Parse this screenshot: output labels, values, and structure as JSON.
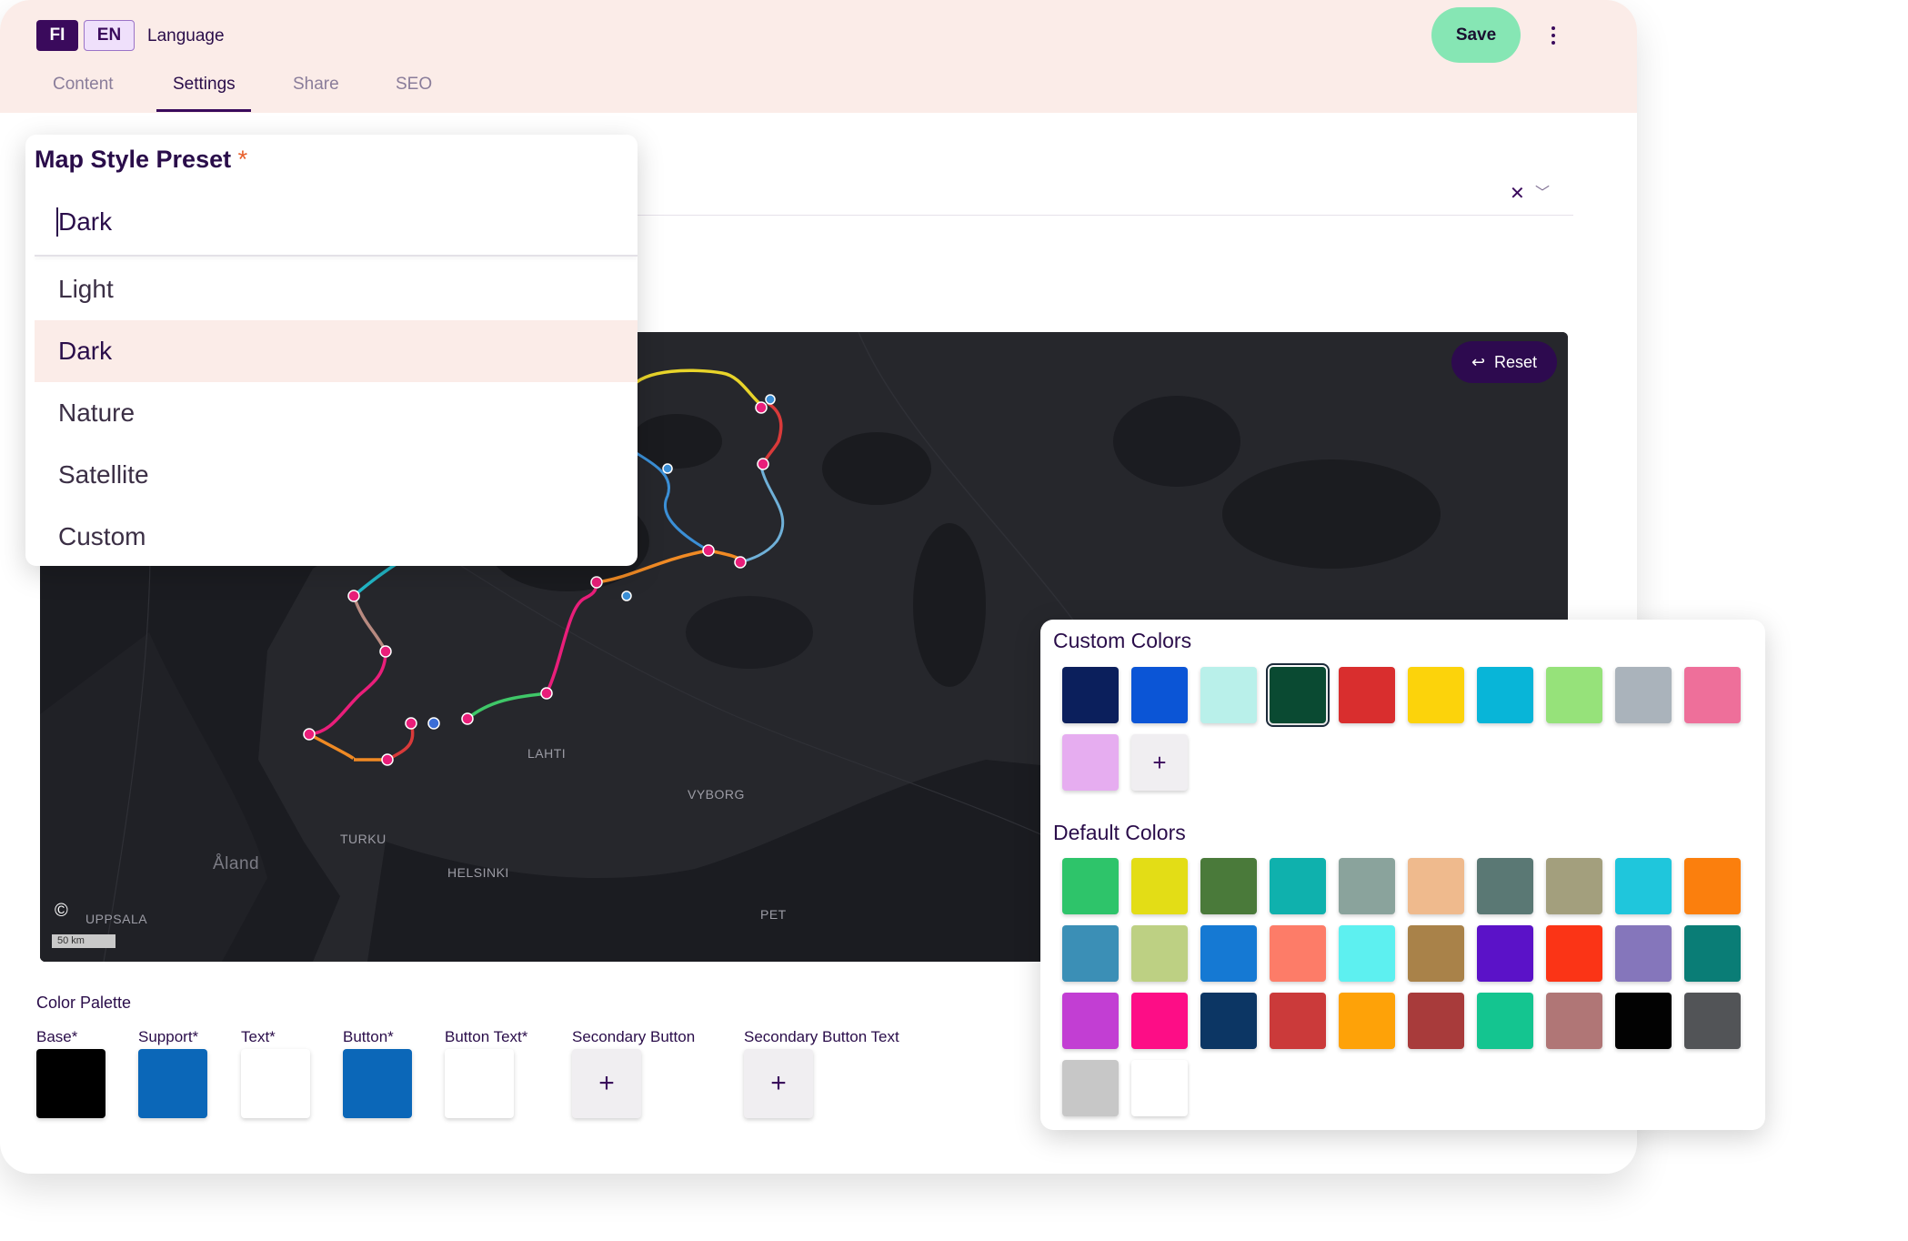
{
  "header": {
    "lang_fi": "FI",
    "lang_en": "EN",
    "language_label": "Language",
    "save_label": "Save",
    "tabs": [
      {
        "label": "Content"
      },
      {
        "label": "Settings"
      },
      {
        "label": "Share"
      },
      {
        "label": "SEO"
      }
    ],
    "active_tab": "Settings"
  },
  "map_style": {
    "title": "Map Style Preset",
    "required_mark": "*",
    "value": "Dark",
    "options": [
      "Light",
      "Dark",
      "Nature",
      "Satellite",
      "Custom"
    ],
    "selected": "Dark"
  },
  "map": {
    "reset_label": "Reset",
    "labels": [
      "LAHTI",
      "VYBORG",
      "TURKU",
      "HELSINKI",
      "Åland",
      "UPPSALA",
      "PET"
    ],
    "scale": "50 km",
    "copyright": "©",
    "route_colors": [
      "#e8d42a",
      "#d93a3a",
      "#3b8fd6",
      "#22b8c8",
      "#f08a24",
      "#a87bd0",
      "#e7b48a",
      "#e91e7a",
      "#b88a80",
      "#3fc768",
      "#6fb0d8"
    ]
  },
  "palette": {
    "title": "Color Palette",
    "items": [
      {
        "label": "Base*",
        "color": "#000000"
      },
      {
        "label": "Support*",
        "color": "#0b67b8"
      },
      {
        "label": "Text*",
        "color": "#ffffff"
      },
      {
        "label": "Button*",
        "color": "#0b67b8"
      },
      {
        "label": "Button Text*",
        "color": "#ffffff"
      },
      {
        "label": "Secondary Button",
        "color": ""
      },
      {
        "label": "Secondary Button Text",
        "color": ""
      }
    ],
    "plus": "+"
  },
  "picker": {
    "custom_title": "Custom Colors",
    "default_title": "Default Colors",
    "custom_colors": [
      "#0b1f5c",
      "#0b55d6",
      "#b9f0ea",
      "#0a4a32",
      "#d92e2e",
      "#fcd30b",
      "#08b5d8",
      "#96e27a",
      "#aab3bb",
      "#ee6f9a",
      "#e6adf0"
    ],
    "selected_custom": "#0a4a32",
    "plus": "+",
    "default_colors": [
      "#2ec46a",
      "#e3dd16",
      "#4a7a3a",
      "#0fb1ad",
      "#8aa39c",
      "#efba8d",
      "#5a7874",
      "#a39f7d",
      "#1fc6dc",
      "#fb7f0d",
      "#3b8fb6",
      "#bdd083",
      "#1579d3",
      "#fd7c68",
      "#5df0f0",
      "#a98249",
      "#5b12c8",
      "#fb3416",
      "#8576bb",
      "#0a7d76",
      "#c23ed3",
      "#fd0d86",
      "#0c3664",
      "#cb3a3a",
      "#fea208",
      "#a83b3b",
      "#14c590",
      "#b07676",
      "#020202",
      "#525457",
      "#c7c7c7",
      "#ffffff"
    ]
  }
}
